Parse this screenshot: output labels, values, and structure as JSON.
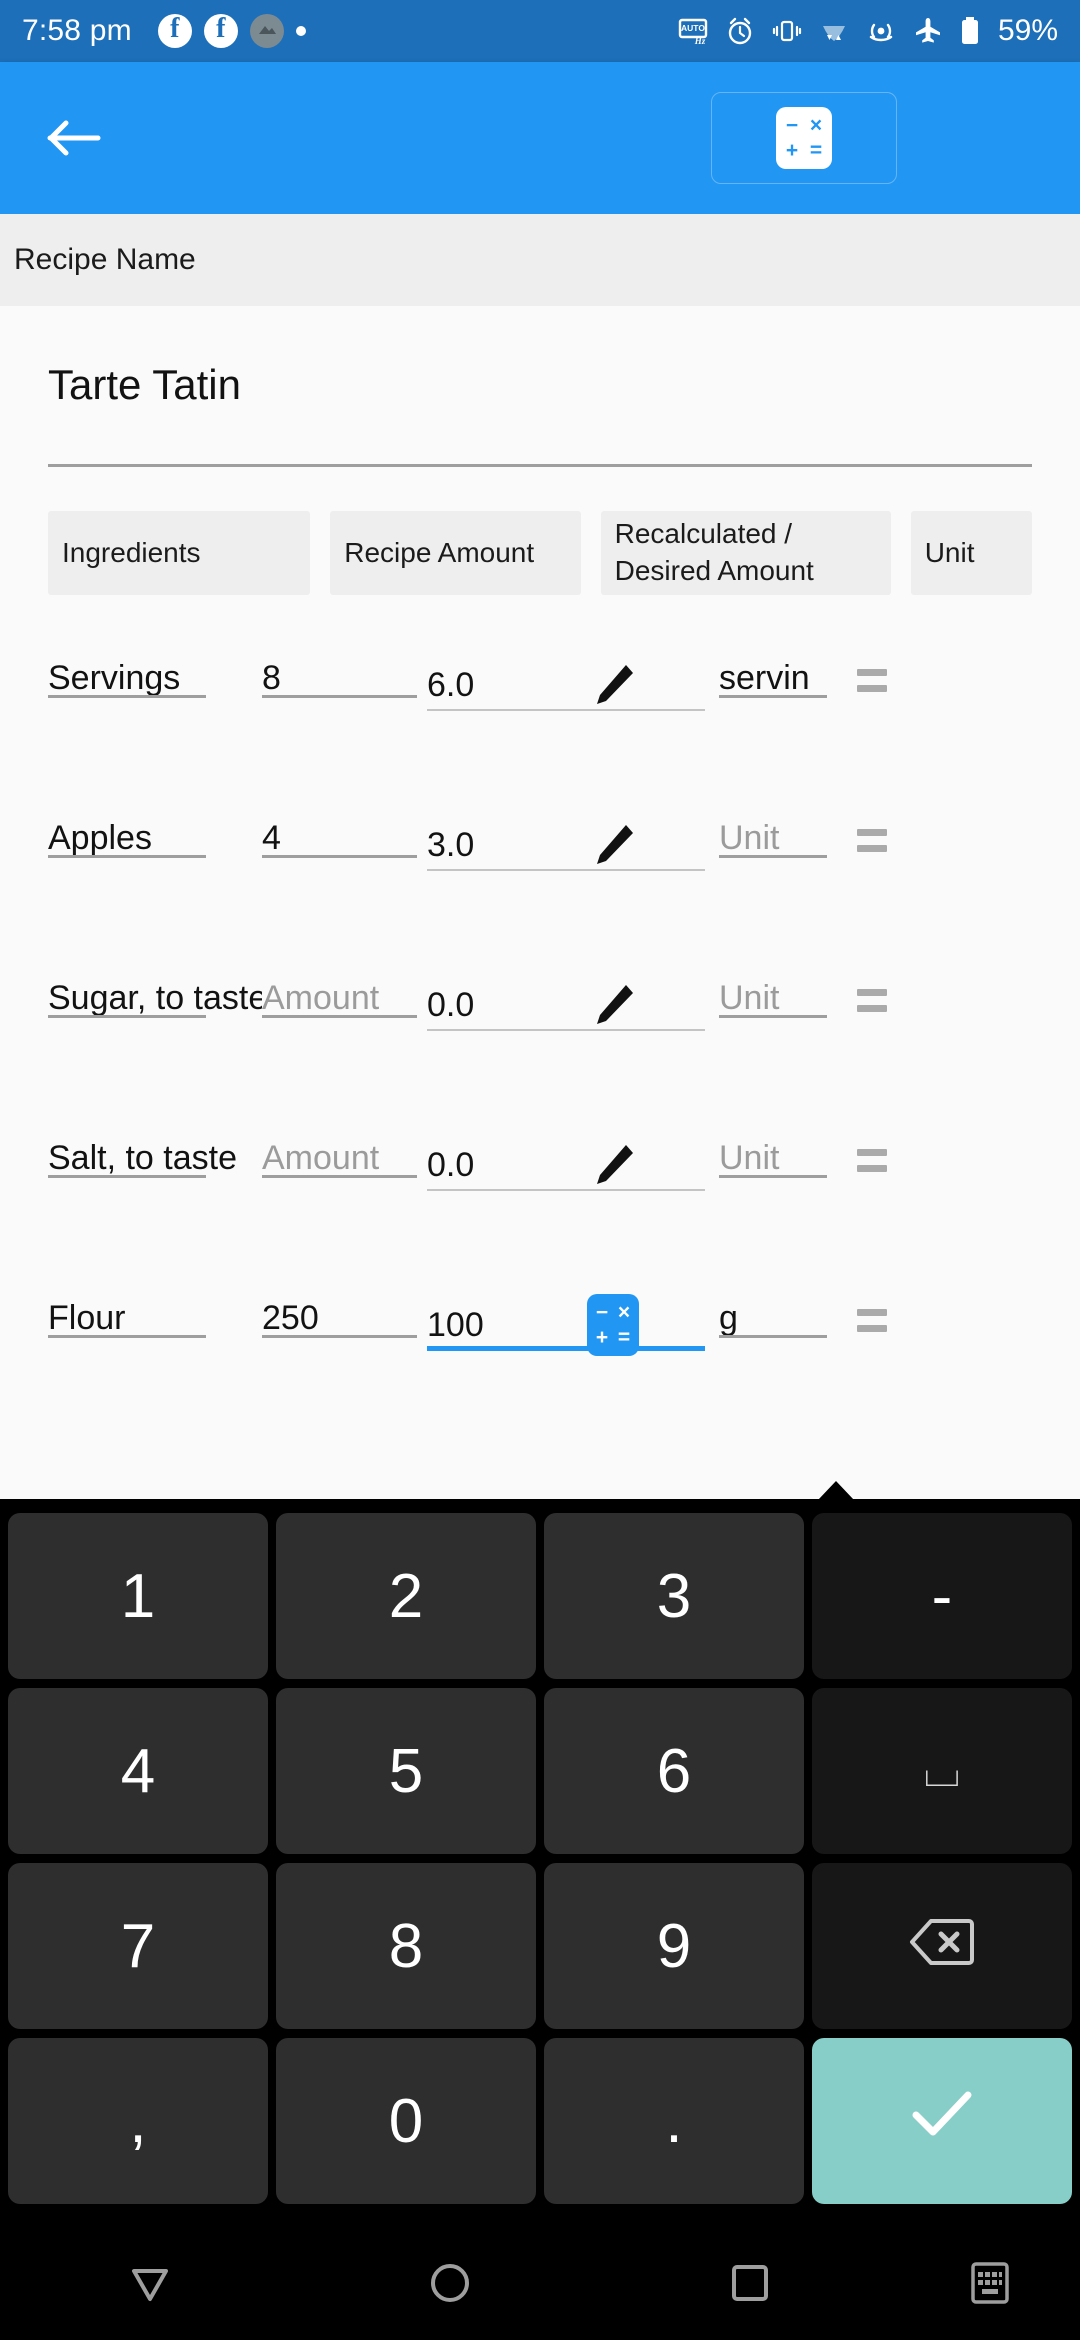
{
  "status_bar": {
    "time": "7:58 pm",
    "battery_percent": "59%",
    "left_icons": [
      "facebook-icon",
      "facebook-icon",
      "app-icon",
      "dot-icon"
    ],
    "right_icons": [
      "auto-hz-icon",
      "alarm-icon",
      "vibrate-icon",
      "wifi-icon",
      "hotspot-icon",
      "airplane-mode-icon",
      "battery-icon"
    ],
    "background_color": "#1c6fb8"
  },
  "app_bar": {
    "back_label": "←",
    "calculator_button_label": "calculator-icon",
    "background_color": "#2196f3"
  },
  "name_bar": {
    "label": "Recipe Name"
  },
  "recipe": {
    "title": "Tarte Tatin"
  },
  "table": {
    "headers": {
      "ingredients": "Ingredients",
      "recipe_amount": "Recipe Amount",
      "recalculated": "Recalculated /\nDesired Amount",
      "unit": "Unit"
    },
    "rows": [
      {
        "ingredient": "Servings",
        "ingredient_is_placeholder": false,
        "recipe_amount": "8",
        "recipe_amount_is_placeholder": false,
        "recalculated": "6.0",
        "action_icon": "pencil-icon",
        "unit": "servin",
        "unit_is_placeholder": false,
        "focused": false
      },
      {
        "ingredient": "Apples",
        "ingredient_is_placeholder": false,
        "recipe_amount": "4",
        "recipe_amount_is_placeholder": false,
        "recalculated": "3.0",
        "action_icon": "pencil-icon",
        "unit": "Unit",
        "unit_is_placeholder": true,
        "focused": false
      },
      {
        "ingredient": "Sugar, to taste",
        "ingredient_is_placeholder": false,
        "recipe_amount": "Amount",
        "recipe_amount_is_placeholder": true,
        "recalculated": "0.0",
        "action_icon": "pencil-icon",
        "unit": "Unit",
        "unit_is_placeholder": true,
        "focused": false
      },
      {
        "ingredient": "Salt, to taste",
        "ingredient_is_placeholder": false,
        "recipe_amount": "Amount",
        "recipe_amount_is_placeholder": true,
        "recalculated": "0.0",
        "action_icon": "pencil-icon",
        "unit": "Unit",
        "unit_is_placeholder": true,
        "focused": false
      },
      {
        "ingredient": "Flour",
        "ingredient_is_placeholder": false,
        "recipe_amount": "250",
        "recipe_amount_is_placeholder": false,
        "recalculated": "100",
        "action_icon": "calculator-icon",
        "unit": "g",
        "unit_is_placeholder": false,
        "focused": true
      }
    ]
  },
  "keyboard": {
    "rows": [
      [
        {
          "label": "1",
          "name": "key-1",
          "type": "digit"
        },
        {
          "label": "2",
          "name": "key-2",
          "type": "digit"
        },
        {
          "label": "3",
          "name": "key-3",
          "type": "digit"
        },
        {
          "label": "-",
          "name": "key-minus",
          "type": "fn"
        }
      ],
      [
        {
          "label": "4",
          "name": "key-4",
          "type": "digit"
        },
        {
          "label": "5",
          "name": "key-5",
          "type": "digit"
        },
        {
          "label": "6",
          "name": "key-6",
          "type": "digit"
        },
        {
          "label": "⌴",
          "name": "key-space",
          "type": "fn-small"
        }
      ],
      [
        {
          "label": "7",
          "name": "key-7",
          "type": "digit"
        },
        {
          "label": "8",
          "name": "key-8",
          "type": "digit"
        },
        {
          "label": "9",
          "name": "key-9",
          "type": "digit"
        },
        {
          "label": "backspace-icon",
          "name": "key-backspace",
          "type": "fn-icon"
        }
      ],
      [
        {
          "label": ",",
          "name": "key-comma",
          "type": "digit"
        },
        {
          "label": "0",
          "name": "key-0",
          "type": "digit"
        },
        {
          "label": ".",
          "name": "key-period",
          "type": "digit"
        },
        {
          "label": "check-icon",
          "name": "key-enter",
          "type": "enter"
        }
      ]
    ],
    "enter_color": "#87cdc8",
    "key_color": "#2e2e2e",
    "fn_key_color": "#171717"
  },
  "nav_bar": {
    "back": "back-triangle-icon",
    "home": "home-circle-icon",
    "recents": "recents-square-icon",
    "keyboard": "keyboard-icon"
  }
}
